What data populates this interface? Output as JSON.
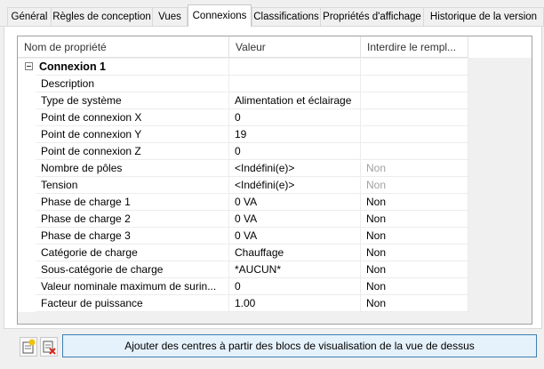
{
  "tabs": [
    {
      "label": "Général"
    },
    {
      "label": "Règles de conception"
    },
    {
      "label": "Vues"
    },
    {
      "label": "Connexions"
    },
    {
      "label": "Classifications"
    },
    {
      "label": "Propriétés d'affichage"
    },
    {
      "label": "Historique de la version"
    }
  ],
  "active_tab": "Connexions",
  "grid": {
    "headers": {
      "name": "Nom de propriété",
      "value": "Valeur",
      "lock": "Interdire le rempl..."
    },
    "group": {
      "label": "Connexion 1",
      "expanded": true
    },
    "rows": [
      {
        "name": "Description",
        "value": "",
        "lock": ""
      },
      {
        "name": "Type de système",
        "value": "Alimentation et éclairage",
        "lock": ""
      },
      {
        "name": "Point de connexion X",
        "value": "0",
        "lock": ""
      },
      {
        "name": "Point de connexion Y",
        "value": "19",
        "lock": ""
      },
      {
        "name": "Point de connexion Z",
        "value": "0",
        "lock": ""
      },
      {
        "name": "Nombre de pôles",
        "value": "<Indéfini(e)>",
        "lock": "Non"
      },
      {
        "name": "Tension",
        "value": "<Indéfini(e)>",
        "lock": "Non"
      },
      {
        "name": "Phase de charge 1",
        "value": "0 VA",
        "lock": "Non"
      },
      {
        "name": "Phase de charge 2",
        "value": "0 VA",
        "lock": "Non"
      },
      {
        "name": "Phase de charge 3",
        "value": "0 VA",
        "lock": "Non"
      },
      {
        "name": "Catégorie de charge",
        "value": "Chauffage",
        "lock": "Non"
      },
      {
        "name": "Sous-catégorie de charge",
        "value": "*AUCUN*",
        "lock": "Non"
      },
      {
        "name": "Valeur nominale maximum de surin...",
        "value": "0",
        "lock": "Non"
      },
      {
        "name": "Facteur de puissance",
        "value": "1.00",
        "lock": "Non"
      }
    ]
  },
  "toolbar": {
    "add_icon": "add-connection-icon",
    "delete_icon": "delete-connection-icon"
  },
  "action_button": {
    "label": "Ajouter des centres à partir des blocs de visualisation de la vue de dessus"
  },
  "colors": {
    "accent_border": "#3c7fb1",
    "button_bg": "#e5f1fb",
    "disabled_text": "#a0a0a0"
  }
}
